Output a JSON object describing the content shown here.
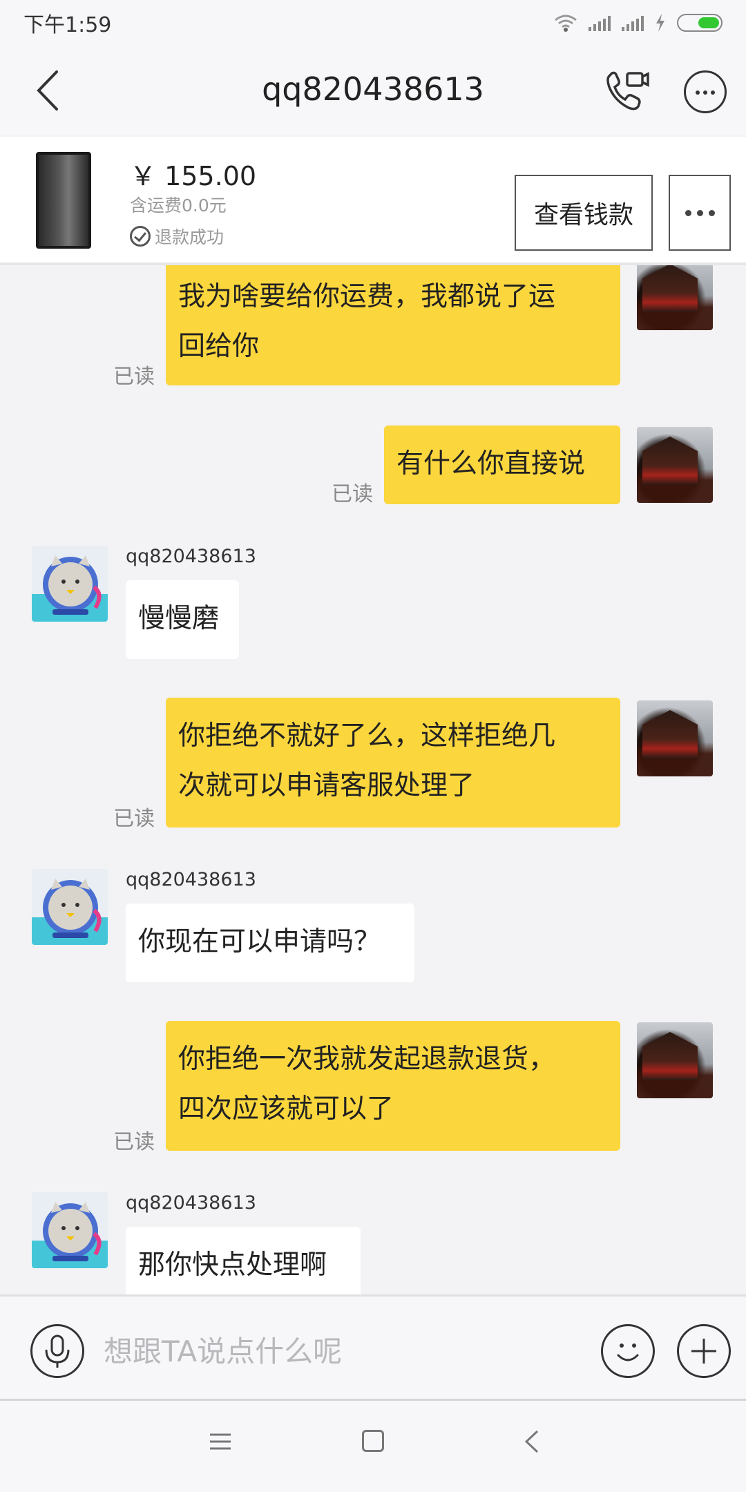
{
  "status_bar": {
    "time": "下午1:59"
  },
  "header": {
    "title": "qq820438613"
  },
  "order": {
    "price": "￥ 155.00",
    "shipping": "含运费0.0元",
    "refund_status": "退款成功",
    "view_money_label": "查看钱款"
  },
  "messages": [
    {
      "from": "me",
      "lines": [
        "我为啥要给你运费，我都说了运",
        "回给你"
      ],
      "read": "已读"
    },
    {
      "from": "me",
      "lines": [
        "有什么你直接说"
      ],
      "read": "已读"
    },
    {
      "from": "them",
      "sender": "qq820438613",
      "lines": [
        "慢慢磨"
      ]
    },
    {
      "from": "me",
      "lines": [
        "你拒绝不就好了么，这样拒绝几",
        "次就可以申请客服处理了"
      ],
      "read": "已读"
    },
    {
      "from": "them",
      "sender": "qq820438613",
      "lines": [
        "你现在可以申请吗？"
      ]
    },
    {
      "from": "me",
      "lines": [
        "你拒绝一次我就发起退款退货，",
        "四次应该就可以了"
      ],
      "read": "已读"
    },
    {
      "from": "them",
      "sender": "qq820438613",
      "lines": [
        "那你快点处理啊"
      ]
    }
  ],
  "input": {
    "placeholder": "想跟TA说点什么呢"
  },
  "icons": {
    "back": "chevron-left-icon",
    "call": "phone-video-icon",
    "more": "ellipsis-circle-icon",
    "mic": "microphone-icon",
    "emoji": "smiley-icon",
    "plus": "plus-icon"
  },
  "colors": {
    "my_bubble": "#fbd63d",
    "their_bubble": "#ffffff",
    "background": "#f3f3f6"
  }
}
